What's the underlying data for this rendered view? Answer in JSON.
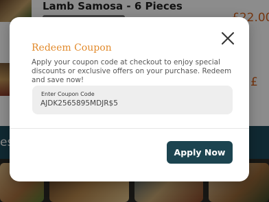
{
  "background": {
    "item1": {
      "title": "Lamb Samosa - 6 Pieces",
      "price": "£22.00"
    },
    "item2": {
      "price": "£"
    },
    "band_text": "es"
  },
  "modal": {
    "title": "Redeem Coupon",
    "description": "Apply your coupon code at checkout to enjoy special discounts or exclusive offers on your purchase. Redeem and save now!",
    "coupon_field": {
      "label": "Enter Coupon Code",
      "value": "AJDK2565895MDJR$5"
    },
    "apply_button_label": "Apply Now",
    "close_icon": "close-icon"
  },
  "colors": {
    "accent_orange": "#e28a2b",
    "primary_button": "#1c4450",
    "price_orange": "#d8631d"
  }
}
